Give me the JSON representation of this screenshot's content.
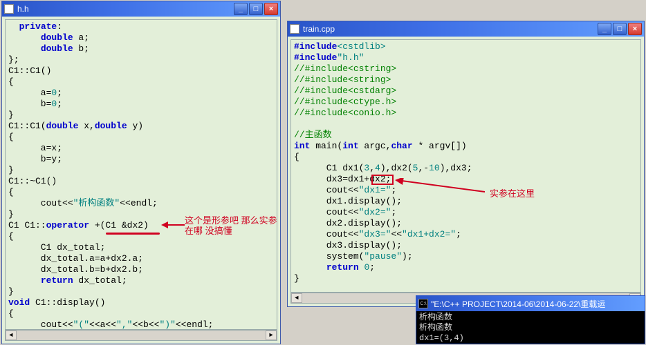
{
  "windows": {
    "left": {
      "title": "h.h",
      "code_lines": [
        {
          "segs": [
            {
              "t": "  "
            },
            {
              "t": "private",
              "c": "kw"
            },
            {
              "t": ":"
            }
          ]
        },
        {
          "segs": [
            {
              "t": "      "
            },
            {
              "t": "double",
              "c": "kw"
            },
            {
              "t": " a;"
            }
          ]
        },
        {
          "segs": [
            {
              "t": "      "
            },
            {
              "t": "double",
              "c": "kw"
            },
            {
              "t": " b;"
            }
          ]
        },
        {
          "segs": [
            {
              "t": "};"
            }
          ]
        },
        {
          "segs": [
            {
              "t": "C1::C1()"
            }
          ]
        },
        {
          "segs": [
            {
              "t": "{"
            }
          ]
        },
        {
          "segs": [
            {
              "t": "      a="
            },
            {
              "t": "0",
              "c": "str"
            },
            {
              "t": ";"
            }
          ]
        },
        {
          "segs": [
            {
              "t": "      b="
            },
            {
              "t": "0",
              "c": "str"
            },
            {
              "t": ";"
            }
          ]
        },
        {
          "segs": [
            {
              "t": "}"
            }
          ]
        },
        {
          "segs": [
            {
              "t": "C1::C1("
            },
            {
              "t": "double",
              "c": "kw"
            },
            {
              "t": " x,"
            },
            {
              "t": "double",
              "c": "kw"
            },
            {
              "t": " y)"
            }
          ]
        },
        {
          "segs": [
            {
              "t": "{"
            }
          ]
        },
        {
          "segs": [
            {
              "t": "      a=x;"
            }
          ]
        },
        {
          "segs": [
            {
              "t": "      b=y;"
            }
          ]
        },
        {
          "segs": [
            {
              "t": "}"
            }
          ]
        },
        {
          "segs": [
            {
              "t": "C1::~C1()"
            }
          ]
        },
        {
          "segs": [
            {
              "t": "{"
            }
          ]
        },
        {
          "segs": [
            {
              "t": "      cout<<"
            },
            {
              "t": "\"析构函数\"",
              "c": "str"
            },
            {
              "t": "<<endl;"
            }
          ]
        },
        {
          "segs": [
            {
              "t": "}"
            }
          ]
        },
        {
          "segs": [
            {
              "t": "C1 C1::"
            },
            {
              "t": "operator",
              "c": "kw"
            },
            {
              "t": " +(C1 &dx2)"
            }
          ]
        },
        {
          "segs": [
            {
              "t": "{"
            }
          ]
        },
        {
          "segs": [
            {
              "t": "      C1 dx_total;"
            }
          ]
        },
        {
          "segs": [
            {
              "t": "      dx_total.a=a+dx2.a;"
            }
          ]
        },
        {
          "segs": [
            {
              "t": "      dx_total.b=b+dx2.b;"
            }
          ]
        },
        {
          "segs": [
            {
              "t": "      "
            },
            {
              "t": "return",
              "c": "kw"
            },
            {
              "t": " dx_total;"
            }
          ]
        },
        {
          "segs": [
            {
              "t": "}"
            }
          ]
        },
        {
          "segs": [
            {
              "t": "void",
              "c": "kw"
            },
            {
              "t": " C1::display()"
            }
          ]
        },
        {
          "segs": [
            {
              "t": "{"
            }
          ]
        },
        {
          "segs": [
            {
              "t": "      cout<<"
            },
            {
              "t": "\"(\"",
              "c": "str"
            },
            {
              "t": "<<a<<"
            },
            {
              "t": "\",\"",
              "c": "str"
            },
            {
              "t": "<<b<<"
            },
            {
              "t": "\")\"",
              "c": "str"
            },
            {
              "t": "<<endl;"
            }
          ]
        },
        {
          "segs": [
            {
              "t": "}"
            }
          ]
        }
      ]
    },
    "right": {
      "title": "train.cpp",
      "code_lines": [
        {
          "segs": [
            {
              "t": "#include",
              "c": "kw"
            },
            {
              "t": "<cstdlib>",
              "c": "str"
            }
          ]
        },
        {
          "segs": [
            {
              "t": "#include",
              "c": "kw"
            },
            {
              "t": "\"h.h\"",
              "c": "str"
            }
          ]
        },
        {
          "segs": [
            {
              "t": "//#include<cstring>",
              "c": "cmt"
            }
          ]
        },
        {
          "segs": [
            {
              "t": "//#include<string>",
              "c": "cmt"
            }
          ]
        },
        {
          "segs": [
            {
              "t": "//#include<cstdarg>",
              "c": "cmt"
            }
          ]
        },
        {
          "segs": [
            {
              "t": "//#include<ctype.h>",
              "c": "cmt"
            }
          ]
        },
        {
          "segs": [
            {
              "t": "//#include<conio.h>",
              "c": "cmt"
            }
          ]
        },
        {
          "segs": [
            {
              "t": ""
            }
          ]
        },
        {
          "segs": [
            {
              "t": "//主函数",
              "c": "cmt"
            }
          ]
        },
        {
          "segs": [
            {
              "t": "int",
              "c": "kw"
            },
            {
              "t": " main("
            },
            {
              "t": "int",
              "c": "kw"
            },
            {
              "t": " argc,"
            },
            {
              "t": "char",
              "c": "kw"
            },
            {
              "t": " * argv[])"
            }
          ]
        },
        {
          "segs": [
            {
              "t": "{"
            }
          ]
        },
        {
          "segs": [
            {
              "t": "      C1 dx1("
            },
            {
              "t": "3",
              "c": "str"
            },
            {
              "t": ","
            },
            {
              "t": "4",
              "c": "str"
            },
            {
              "t": "),dx2("
            },
            {
              "t": "5",
              "c": "str"
            },
            {
              "t": ",-"
            },
            {
              "t": "10",
              "c": "str"
            },
            {
              "t": "),dx3;"
            }
          ]
        },
        {
          "segs": [
            {
              "t": "      dx3=dx1+dx2;"
            }
          ]
        },
        {
          "segs": [
            {
              "t": "      cout<<"
            },
            {
              "t": "\"dx1=\"",
              "c": "str"
            },
            {
              "t": ";"
            }
          ]
        },
        {
          "segs": [
            {
              "t": "      dx1.display();"
            }
          ]
        },
        {
          "segs": [
            {
              "t": "      cout<<"
            },
            {
              "t": "\"dx2=\"",
              "c": "str"
            },
            {
              "t": ";"
            }
          ]
        },
        {
          "segs": [
            {
              "t": "      dx2.display();"
            }
          ]
        },
        {
          "segs": [
            {
              "t": "      cout<<"
            },
            {
              "t": "\"dx3=\"",
              "c": "str"
            },
            {
              "t": "<<"
            },
            {
              "t": "\"dx1+dx2=\"",
              "c": "str"
            },
            {
              "t": ";"
            }
          ]
        },
        {
          "segs": [
            {
              "t": "      dx3.display();"
            }
          ]
        },
        {
          "segs": [
            {
              "t": "      system("
            },
            {
              "t": "\"pause\"",
              "c": "str"
            },
            {
              "t": ");"
            }
          ]
        },
        {
          "segs": [
            {
              "t": "      "
            },
            {
              "t": "return",
              "c": "kw"
            },
            {
              "t": " "
            },
            {
              "t": "0",
              "c": "str"
            },
            {
              "t": ";"
            }
          ]
        },
        {
          "segs": [
            {
              "t": "}"
            }
          ]
        }
      ]
    }
  },
  "annotation_left": "这个是形参吧\n那么实参在哪\n没搞懂",
  "annotation_right": "实参在这里",
  "console": {
    "title": "\"E:\\C++ PROJECT\\2014-06\\2014-06-22\\重载运",
    "lines": [
      "析构函数",
      "析构函数",
      "dx1=(3,4)"
    ]
  },
  "wbtn_labels": {
    "min": "_",
    "max": "□",
    "close": "×"
  },
  "scroll_arrows": {
    "left": "◄",
    "right": "►"
  },
  "console_icon": "C:\\"
}
